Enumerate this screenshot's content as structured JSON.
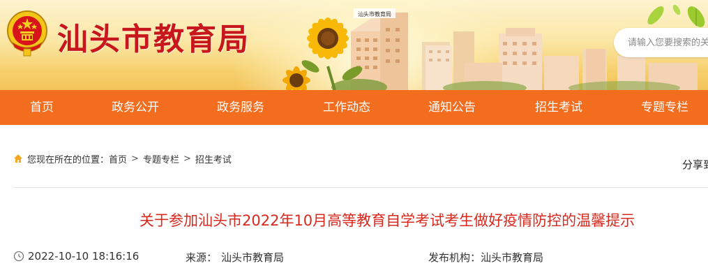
{
  "header": {
    "site_title": "汕头市教育局",
    "building_sign": "汕头市教育局",
    "brand_color": "#c8161d",
    "emblem_icon": "national-emblem-icon"
  },
  "search": {
    "placeholder": "请输入您要搜索的关键词"
  },
  "nav": {
    "background": "#f36d1e",
    "items": [
      {
        "label": "首页"
      },
      {
        "label": "政务公开"
      },
      {
        "label": "政务服务"
      },
      {
        "label": "工作动态"
      },
      {
        "label": "通知公告"
      },
      {
        "label": "招生考试"
      },
      {
        "label": "专题专栏"
      }
    ]
  },
  "breadcrumb": {
    "icon": "home-icon",
    "prefix": "您现在所在的位置：",
    "items": [
      "首页",
      "专题专栏",
      "招生考试"
    ],
    "separator": ">"
  },
  "share": {
    "label": "分享到"
  },
  "article": {
    "title": "关于参加汕头市2022年10月高等教育自学考试考生做好疫情防控的温馨提示",
    "title_color": "#d9281e",
    "datetime": "2022-10-10 18:16:16",
    "source_label": "来源：",
    "source_value": "汕头市教育局",
    "publisher_label": "发布机构：",
    "publisher_value": "汕头市教育局"
  }
}
